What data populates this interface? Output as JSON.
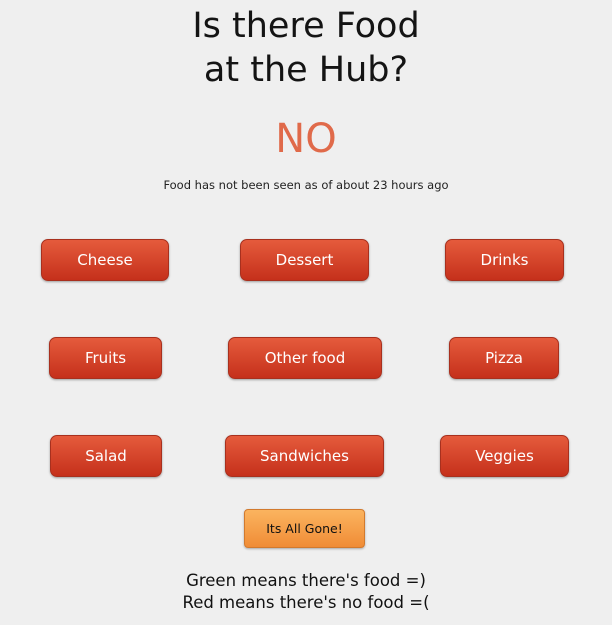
{
  "header": {
    "title_line1": "Is there Food",
    "title_line2": "at the Hub?"
  },
  "answer": "NO",
  "status_text": "Food has not been seen as of about 23 hours ago",
  "food_buttons": [
    {
      "label": "Cheese",
      "state": "red"
    },
    {
      "label": "Dessert",
      "state": "red"
    },
    {
      "label": "Drinks",
      "state": "red"
    },
    {
      "label": "Fruits",
      "state": "red"
    },
    {
      "label": "Other food",
      "state": "red"
    },
    {
      "label": "Pizza",
      "state": "red"
    },
    {
      "label": "Salad",
      "state": "red"
    },
    {
      "label": "Sandwiches",
      "state": "red"
    },
    {
      "label": "Veggies",
      "state": "red"
    }
  ],
  "all_gone_button": "Its All Gone!",
  "legend": {
    "line1": "Green means there's food =)",
    "line2": "Red means there's no food =("
  },
  "colors": {
    "no_answer": "#e06a4a",
    "button_red": "#d2402a",
    "button_orange": "#f5a04a",
    "background": "#efefef"
  }
}
